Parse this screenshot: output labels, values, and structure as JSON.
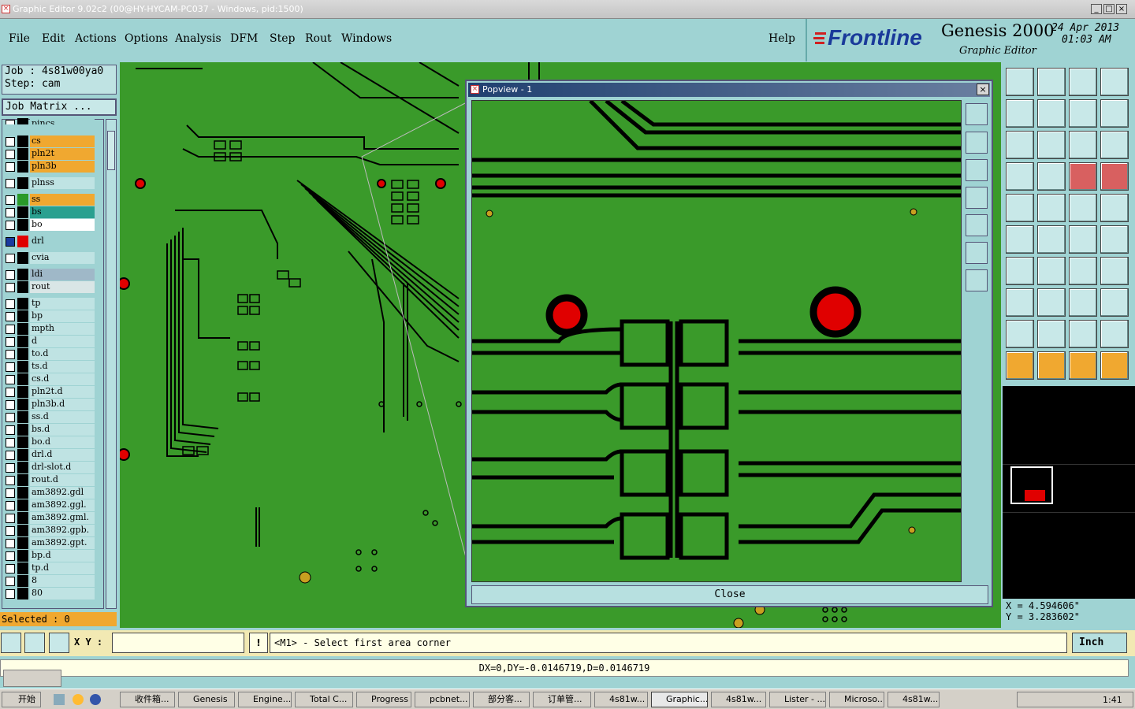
{
  "window": {
    "title": "Graphic Editor 9.02c2 (00@HY-HYCAM-PC037 - Windows, pid:1500)"
  },
  "menu": [
    "File",
    "Edit",
    "Actions",
    "Options",
    "Analysis",
    "DFM",
    "Step",
    "Rout",
    "Windows"
  ],
  "help": "Help",
  "brand": {
    "logo": "Frontline",
    "product": "Genesis 2000",
    "subtitle": "Graphic Editor",
    "date": "24 Apr 2013",
    "time": "01:03 AM"
  },
  "job": {
    "job_label": "Job : 4s81w00ya0",
    "step_label": "Step: cam",
    "matrix_button": "Job Matrix ..."
  },
  "layers": [
    {
      "name": "pincs",
      "color": "#9fd3d3",
      "swatch": "#000"
    },
    {
      "name": "cs",
      "color": "#f0a830",
      "swatch": "#000"
    },
    {
      "name": "pln2t",
      "color": "#f0a830",
      "swatch": "#000"
    },
    {
      "name": "pln3b",
      "color": "#f0a830",
      "swatch": "#000"
    },
    {
      "name": "plnss",
      "color": "#bfe3e3",
      "swatch": "#000"
    },
    {
      "name": "ss",
      "color": "#f0a830",
      "swatch": "#2a9a2a"
    },
    {
      "name": "bs",
      "color": "#2aa090",
      "swatch": "#000"
    },
    {
      "name": "bo",
      "color": "#ffffff",
      "swatch": "#000"
    },
    {
      "name": "drl",
      "color": "#9fd3d3",
      "swatch": "#e00000"
    },
    {
      "name": "cvia",
      "color": "#bfe3e3",
      "swatch": "#000"
    },
    {
      "name": "ldi",
      "color": "#9fb8c8",
      "swatch": "#000"
    },
    {
      "name": "rout",
      "color": "#d9e6e6",
      "swatch": "#000"
    },
    {
      "name": "tp",
      "color": "#bfe3e3",
      "swatch": "#000"
    },
    {
      "name": "bp",
      "color": "#bfe3e3",
      "swatch": "#000"
    },
    {
      "name": "mpth",
      "color": "#bfe3e3",
      "swatch": "#000"
    },
    {
      "name": "d",
      "color": "#bfe3e3",
      "swatch": "#000"
    },
    {
      "name": "to.d",
      "color": "#bfe3e3",
      "swatch": "#000"
    },
    {
      "name": "ts.d",
      "color": "#bfe3e3",
      "swatch": "#000"
    },
    {
      "name": "cs.d",
      "color": "#bfe3e3",
      "swatch": "#000"
    },
    {
      "name": "pln2t.d",
      "color": "#bfe3e3",
      "swatch": "#000"
    },
    {
      "name": "pln3b.d",
      "color": "#bfe3e3",
      "swatch": "#000"
    },
    {
      "name": "ss.d",
      "color": "#bfe3e3",
      "swatch": "#000"
    },
    {
      "name": "bs.d",
      "color": "#bfe3e3",
      "swatch": "#000"
    },
    {
      "name": "bo.d",
      "color": "#bfe3e3",
      "swatch": "#000"
    },
    {
      "name": "drl.d",
      "color": "#bfe3e3",
      "swatch": "#000"
    },
    {
      "name": "drl-slot.d",
      "color": "#bfe3e3",
      "swatch": "#000"
    },
    {
      "name": "rout.d",
      "color": "#bfe3e3",
      "swatch": "#000"
    },
    {
      "name": "am3892.gdl",
      "color": "#bfe3e3",
      "swatch": "#000"
    },
    {
      "name": "am3892.ggl.",
      "color": "#bfe3e3",
      "swatch": "#000"
    },
    {
      "name": "am3892.gml.",
      "color": "#bfe3e3",
      "swatch": "#000"
    },
    {
      "name": "am3892.gpb.",
      "color": "#bfe3e3",
      "swatch": "#000"
    },
    {
      "name": "am3892.gpt.",
      "color": "#bfe3e3",
      "swatch": "#000"
    },
    {
      "name": "bp.d",
      "color": "#bfe3e3",
      "swatch": "#000"
    },
    {
      "name": "tp.d",
      "color": "#bfe3e3",
      "swatch": "#000"
    },
    {
      "name": "8",
      "color": "#bfe3e3",
      "swatch": "#000"
    },
    {
      "name": "80",
      "color": "#bfe3e3",
      "swatch": "#000"
    }
  ],
  "selected": "Selected : 0",
  "popview": {
    "title": "Popview - 1",
    "close": "Close"
  },
  "coords": {
    "x": "X = 4.594606\"",
    "y": "Y = 3.283602\""
  },
  "status": {
    "xy_label": "X Y :",
    "xy_value": "",
    "prompt": "<M1> - Select first area corner",
    "units": "Inch"
  },
  "dx": "DX=0,DY=-0.0146719,D=0.0146719",
  "taskbar": {
    "start": "开始",
    "clock": "1:41",
    "tasks": [
      "收件箱...",
      "Genesis",
      "Engine...",
      "Total C...",
      "Progress",
      "pcbnet...",
      "部分客...",
      "订单管...",
      "4s81w...",
      "Graphic...",
      "4s81w...",
      "Lister - ...",
      "Microso...",
      "4s81w..."
    ]
  }
}
